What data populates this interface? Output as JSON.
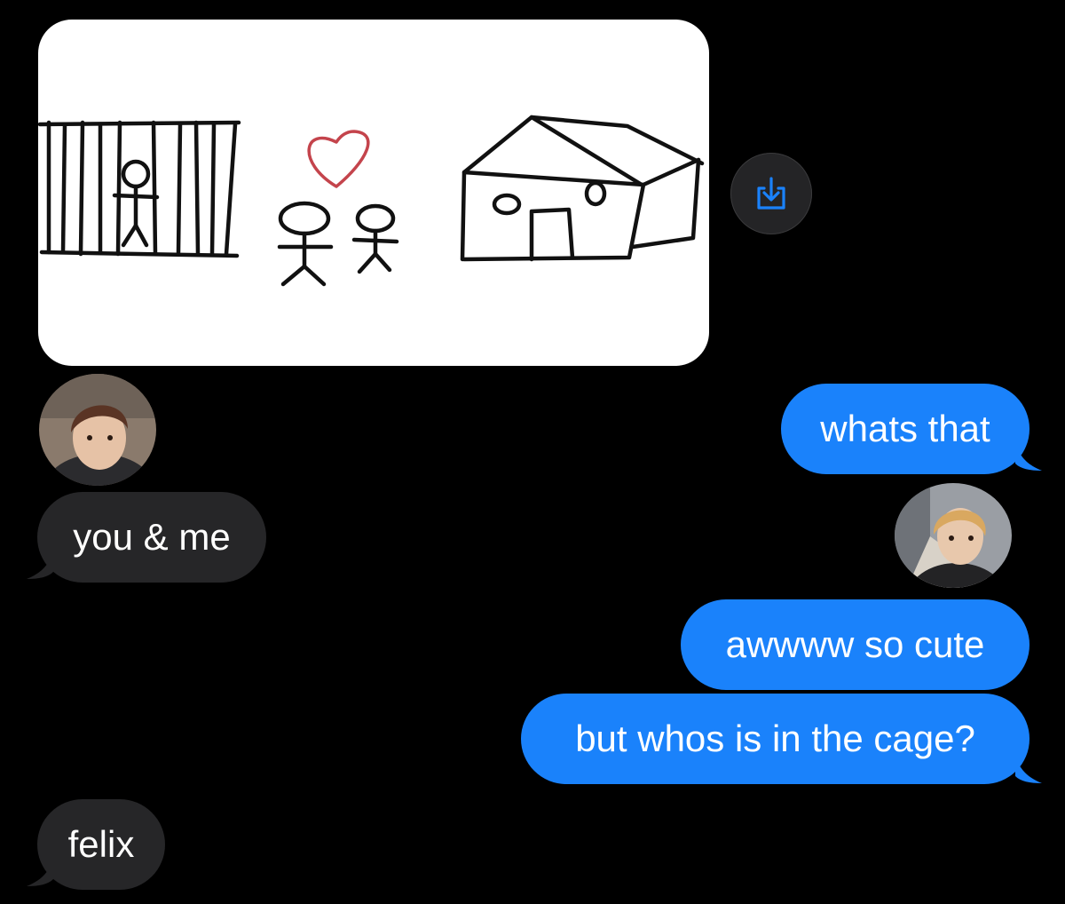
{
  "conversation": {
    "image_message": {
      "description_icon": "drawing-image",
      "save_icon": "save-to-device-icon"
    },
    "messages": [
      {
        "id": "m1",
        "sender": "me",
        "text": "whats that"
      },
      {
        "id": "m2",
        "sender": "other",
        "text": "you & me"
      },
      {
        "id": "m3",
        "sender": "me",
        "text": "awwww so cute"
      },
      {
        "id": "m4",
        "sender": "me",
        "text": "but whos is in the cage?"
      },
      {
        "id": "m5",
        "sender": "other",
        "text": "felix"
      }
    ]
  },
  "colors": {
    "background": "#000000",
    "incoming_bubble": "#262628",
    "outgoing_bubble": "#1a82fb",
    "save_icon": "#1a82fb"
  }
}
